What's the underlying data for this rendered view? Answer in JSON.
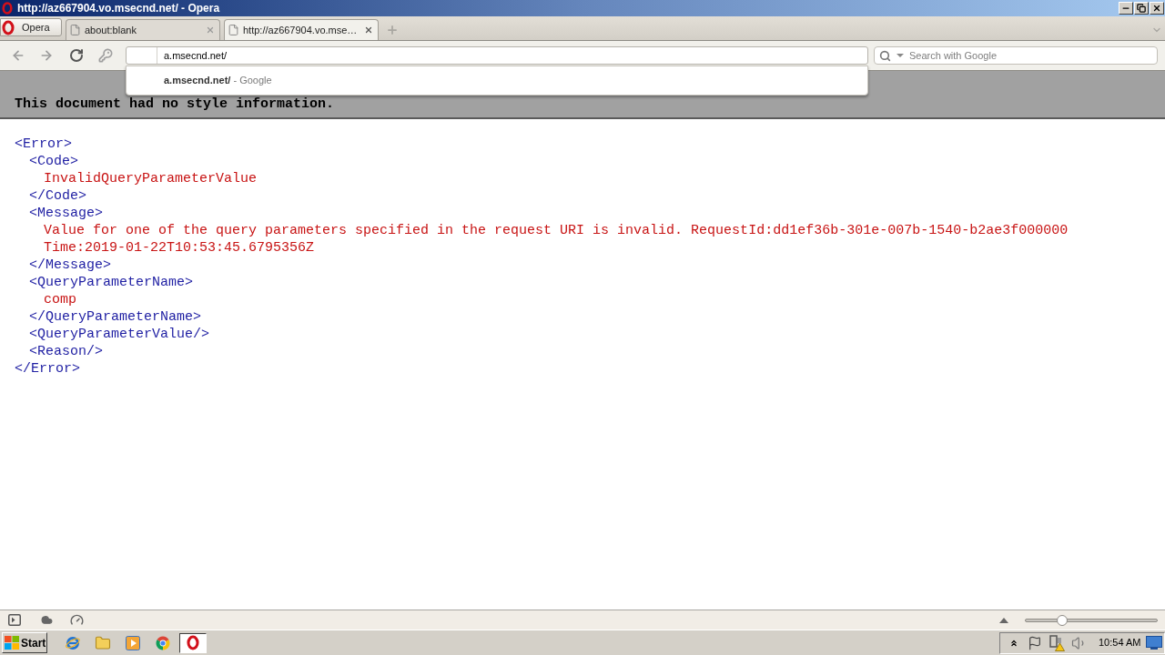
{
  "window": {
    "title": "http://az667904.vo.msecnd.net/ - Opera"
  },
  "menu_button": {
    "label": "Opera"
  },
  "tabs": [
    {
      "label": "about:blank",
      "selected": false
    },
    {
      "label": "http://az667904.vo.mse…",
      "selected": true
    }
  ],
  "address_bar": {
    "value": "a.msecnd.net/"
  },
  "address_suggestions": [
    {
      "url": "a.msecnd.net/",
      "detail": "- Google"
    }
  ],
  "search": {
    "placeholder": "Search with Google"
  },
  "notice": "This document had no style information.",
  "document": [
    {
      "kind": "element",
      "open": "<Error>",
      "close": "</Error>",
      "children": [
        {
          "kind": "element",
          "open": "<Code>",
          "close": "</Code>",
          "children": [
            {
              "kind": "text",
              "text": "InvalidQueryParameterValue"
            }
          ]
        },
        {
          "kind": "element",
          "open": "<Message>",
          "close": "</Message>",
          "children": [
            {
              "kind": "text",
              "text": "Value for one of the query parameters specified in the request URI is invalid. RequestId:dd1ef36b-301e-007b-1540-b2ae3f000000 Time:2019-01-22T10:53:45.6795356Z"
            }
          ]
        },
        {
          "kind": "element",
          "open": "<QueryParameterName>",
          "close": "</QueryParameterName>",
          "children": [
            {
              "kind": "text",
              "text": "comp"
            }
          ]
        },
        {
          "kind": "empty",
          "tag": "<QueryParameterValue/>"
        },
        {
          "kind": "empty",
          "tag": "<Reason/>"
        }
      ]
    }
  ],
  "status_bar": {
    "zoom": {
      "level": 0.28
    }
  },
  "taskbar": {
    "start": "Start",
    "apps": [
      {
        "selected": false
      },
      {
        "selected": false
      },
      {
        "selected": false
      },
      {
        "selected": false
      },
      {
        "selected": true
      }
    ],
    "clock": "10:54 AM"
  }
}
